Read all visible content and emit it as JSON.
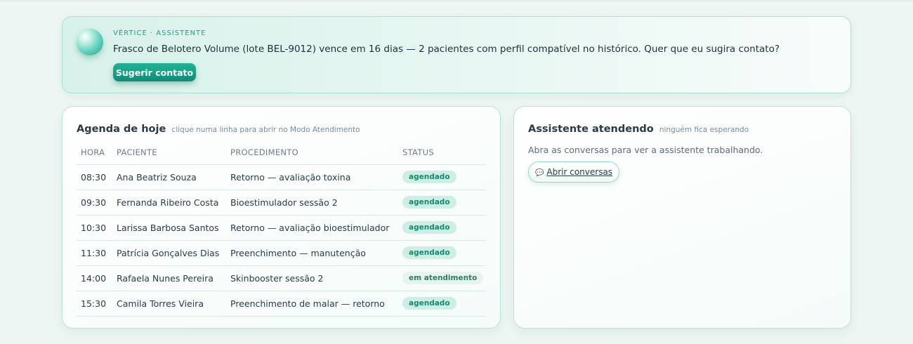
{
  "alert": {
    "eyebrow": "VÉRTICE · ASSISTENTE",
    "message": "Frasco de Belotero Volume (lote BEL-9012) vence em 16 dias — 2 pacientes com perfil compatível no histórico. Quer que eu sugira contato?",
    "action_label": "Sugerir contato",
    "orb_icon": "assistant-orb-icon"
  },
  "agenda": {
    "title": "Agenda de hoje",
    "subtitle": "clique numa linha para abrir no Modo Atendimento",
    "columns": [
      "HORA",
      "PACIENTE",
      "PROCEDIMENTO",
      "STATUS"
    ],
    "rows": [
      {
        "hora": "08:30",
        "paciente": "Ana Beatriz Souza",
        "procedimento": "Retorno — avaliação toxina",
        "status": "agendado"
      },
      {
        "hora": "09:30",
        "paciente": "Fernanda Ribeiro Costa",
        "procedimento": "Bioestimulador sessão 2",
        "status": "agendado"
      },
      {
        "hora": "10:30",
        "paciente": "Larissa Barbosa Santos",
        "procedimento": "Retorno — avaliação bioestimulador",
        "status": "agendado"
      },
      {
        "hora": "11:30",
        "paciente": "Patrícia Gonçalves Dias",
        "procedimento": "Preenchimento — manutenção",
        "status": "agendado"
      },
      {
        "hora": "14:00",
        "paciente": "Rafaela Nunes Pereira",
        "procedimento": "Skinbooster sessão 2",
        "status": "em atendimento"
      },
      {
        "hora": "15:30",
        "paciente": "Camila Torres Vieira",
        "procedimento": "Preenchimento de malar — retorno",
        "status": "agendado"
      }
    ]
  },
  "assistant_panel": {
    "title": "Assistente atendendo",
    "subtitle": "ninguém fica esperando",
    "description": "Abra as conversas para ver a assistente trabalhando.",
    "button_label": "Abrir conversas",
    "button_icon": "chat-bubble-icon"
  },
  "colors": {
    "accent": "#1fb596",
    "badge_bg": "#cdeee5",
    "badge_text": "#148a70"
  }
}
